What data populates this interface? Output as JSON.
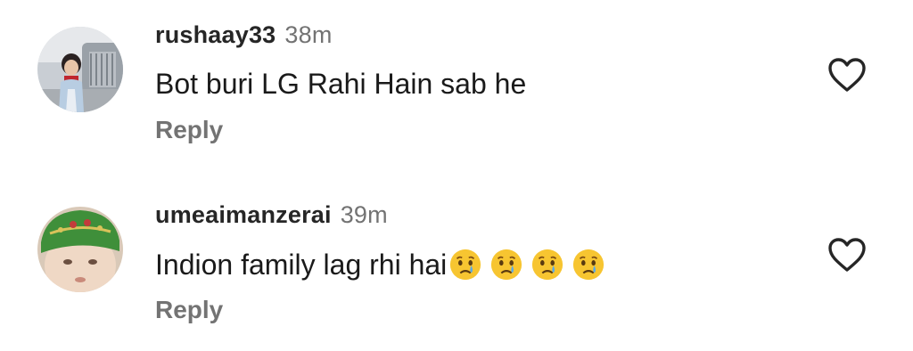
{
  "comments": [
    {
      "username": "rushaay33",
      "time": "38m",
      "text": "Bot buri LG Rahi Hain sab he",
      "emojis": [],
      "reply_label": "Reply",
      "avatar_icon": "user-photo-girl-car"
    },
    {
      "username": "umeaimanzerai",
      "time": "39m",
      "text": "Indion family lag rhi hai",
      "emojis": [
        "crying-face",
        "crying-face",
        "crying-face",
        "crying-face"
      ],
      "reply_label": "Reply",
      "avatar_icon": "user-photo-baby-green-cap"
    }
  ],
  "colors": {
    "username": "#262626",
    "secondary": "#737373",
    "text": "#1a1a1a",
    "heart_stroke": "#262626",
    "emoji_yellow": "#f7c531",
    "emoji_tear": "#5aa9e6"
  }
}
